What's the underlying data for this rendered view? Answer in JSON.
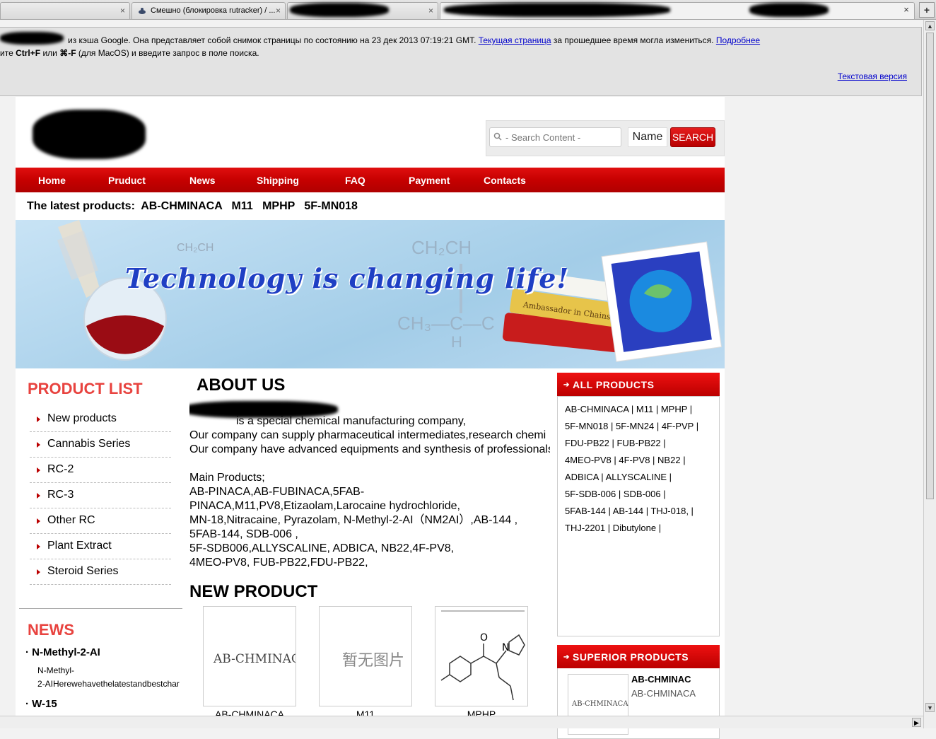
{
  "browser": {
    "tabs": [
      {
        "title": ""
      },
      {
        "title": "Смешно (блокировка rutracker) / ..."
      },
      {
        "title": ""
      }
    ],
    "close_symbol": "×",
    "new_tab_symbol": "+"
  },
  "cache_banner": {
    "line1_a": "из кэша Google. Она представляет собой снимок страницы по состоянию на 23 дек 2013 07:19:21 GMT.",
    "current_page_link": "Текущая страница",
    "line1_b": "за прошедшее время могла измениться.",
    "more_link": "Подробнее",
    "line2_a": "ите",
    "line2_key1": "Ctrl+F",
    "line2_b": "или",
    "line2_key2": "⌘-F",
    "line2_c": "(для MacOS) и введите запрос в поле поиска.",
    "text_version_link": "Текстовая версия"
  },
  "search": {
    "placeholder": "- Search Content -",
    "name_label": "Name",
    "button_label": "SEARCH"
  },
  "nav": [
    {
      "label": "Home"
    },
    {
      "label": "Pruduct"
    },
    {
      "label": "News"
    },
    {
      "label": "Shipping"
    },
    {
      "label": "FAQ"
    },
    {
      "label": "Payment"
    },
    {
      "label": "Contacts"
    }
  ],
  "latest": {
    "label": "The latest products:",
    "items": [
      "AB-CHMINACA",
      "M11",
      "MPHP",
      "5F-MN018"
    ]
  },
  "banner": {
    "tagline": "Technology is changing life!",
    "book_text": "Ambassador in Chains",
    "formula_top": "CH₂CH",
    "formula_mid": "CH₃—C—C",
    "formula_h": "H",
    "formula_left": "CH₂CH"
  },
  "product_list": {
    "title": "PRODUCT LIST",
    "items": [
      "New products",
      "Cannabis Series",
      "RC-2",
      "RC-3",
      "Other RC",
      "Plant Extract",
      "Steroid Series"
    ]
  },
  "news": {
    "title": "NEWS",
    "items": [
      {
        "title": "N-Methyl-2-AI",
        "line1": "N-Methyl-",
        "line2": "2-AIHerewehavethelatestandbestchar"
      },
      {
        "title": "W-15"
      }
    ]
  },
  "about": {
    "title": "ABOUT US",
    "lines": [
      "is a special chemical manufacturing company,",
      "Our company can supply  pharmaceutical intermediates,research chemi",
      "Our company have advanced equipments and synthesis of professionals",
      "",
      "Main Products;",
      "AB-PINACA,AB-FUBINACA,5FAB-",
      "PINACA,M11,PV8,Etizaolam,Larocaine hydrochloride,",
      "MN-18,Nitracaine, Pyrazolam, N-Methyl-2-AI（NM2AI）,AB-144 ,",
      "5FAB-144, SDB-006 ,",
      "5F-SDB006,ALLYSCALINE, ADBICA, NB22,4F-PV8,",
      "4MEO-PV8, FUB-PB22,FDU-PB22,"
    ]
  },
  "new_product": {
    "title": "NEW PRODUCT",
    "items": [
      {
        "name": "AB-CHMINACA",
        "image_text": "AB-CHMINACA"
      },
      {
        "name": "M11",
        "image_text": "暂无图片"
      },
      {
        "name": "MPHP",
        "image_text": ""
      }
    ]
  },
  "all_products": {
    "title": "ALL PRODUCTS",
    "rows": [
      [
        "AB-CHMINACA",
        "M11",
        "MPHP"
      ],
      [
        "5F-MN018",
        "5F-MN24",
        "4F-PVP"
      ],
      [
        "FDU-PB22",
        "FUB-PB22"
      ],
      [
        "4MEO-PV8",
        "4F-PV8",
        "NB22"
      ],
      [
        "ADBICA",
        "ALLYSCALINE"
      ],
      [
        "5F-SDB-006",
        "SDB-006"
      ],
      [
        "5FAB-144",
        "AB-144",
        "THJ-018,"
      ],
      [
        "THJ-2201",
        "Dibutylone"
      ]
    ]
  },
  "superior_products": {
    "title": "SUPERIOR PRODUCTS",
    "item_title": "AB-CHMINAC",
    "item_sub": "AB-CHMINACA",
    "image_text": "AB-CHMINACA"
  },
  "colors": {
    "accent_red": "#d00000",
    "section_title": "#e8433f",
    "link_blue": "#0000cc"
  }
}
